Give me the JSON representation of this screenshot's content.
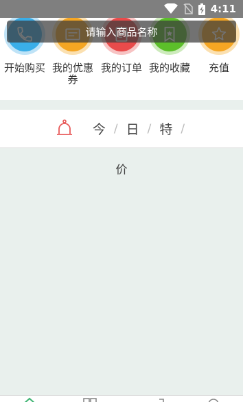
{
  "status_bar": {
    "time": "4:11",
    "icons": [
      "wifi-icon",
      "no-sim-icon",
      "battery-charging-icon"
    ]
  },
  "search": {
    "placeholder": "请输入商品名称"
  },
  "quick_menu": [
    {
      "label": "开始购买",
      "icon": "phone-icon",
      "color": "#3aaee8",
      "ring": "#bfe3f7"
    },
    {
      "label": "我的优惠券",
      "icon": "coupon-icon",
      "color": "#f5a623",
      "ring": "#fbe0b0"
    },
    {
      "label": "我的订单",
      "icon": "order-icon",
      "color": "#e94b4b",
      "ring": "#f7c3c3"
    },
    {
      "label": "我的收藏",
      "icon": "star-badge-icon",
      "color": "#5cbf2a",
      "ring": "#cdebbc"
    },
    {
      "label": "充值",
      "icon": "star-icon",
      "color": "#f5a623",
      "ring": "#fbe0b0"
    }
  ],
  "deals": {
    "icon": "bell-icon",
    "title_chars": [
      "今",
      "日",
      "特"
    ],
    "last_char": "价",
    "accent": "#e85b5b"
  },
  "bottom_nav": [
    {
      "icon": "home-icon",
      "color": "#3cb371"
    },
    {
      "icon": "grid-icon",
      "color": "#888888"
    },
    {
      "icon": "cart-icon",
      "color": "#888888"
    },
    {
      "icon": "user-icon",
      "color": "#888888"
    }
  ]
}
